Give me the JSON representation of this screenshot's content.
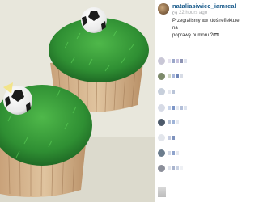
{
  "post": {
    "username": "nataliasiwiec_iamreal",
    "time": "22 hours ago",
    "caption": "Przegraliśmy 🎟 ktoś reflektuje na\npoprawę humoru ?🎟"
  },
  "photo": {
    "description_icon": "cupcake-photo"
  },
  "comments": [
    {
      "avatar_color": "#c9c7d6",
      "blocks": [
        "#e6e2ee",
        "#9aa7c9",
        "#c7c2de",
        "#8d93b3",
        "#dfe3ee"
      ]
    },
    {
      "avatar_color": "#7d8a6a",
      "blocks": [
        "#cfd7c3",
        "#a8b6d9",
        "#6f86b8",
        "#d7dce6"
      ]
    },
    {
      "avatar_color": "#c7cfdb",
      "blocks": [
        "#e5e7ee",
        "#b9c4d8"
      ]
    },
    {
      "avatar_color": "#d7dbe6",
      "blocks": [
        "#c7d3ea",
        "#7d96c7",
        "#e5e9f1",
        "#b3bfd9",
        "#dde3ee"
      ]
    },
    {
      "avatar_color": "#4d5a6a",
      "blocks": [
        "#b6c2d6",
        "#9eb3d8",
        "#e4e8f0"
      ]
    },
    {
      "avatar_color": "#e3e6ec",
      "blocks": [
        "#c4cbe0",
        "#7f93bd"
      ]
    },
    {
      "avatar_color": "#6c7d8d",
      "blocks": [
        "#d3d9e6",
        "#8ea3cc",
        "#e5e8ef"
      ]
    },
    {
      "avatar_color": "#8c8f9a",
      "blocks": [
        "#dfe3ec",
        "#a9b4cd",
        "#c9d2e3",
        "#eef0f4"
      ]
    }
  ]
}
